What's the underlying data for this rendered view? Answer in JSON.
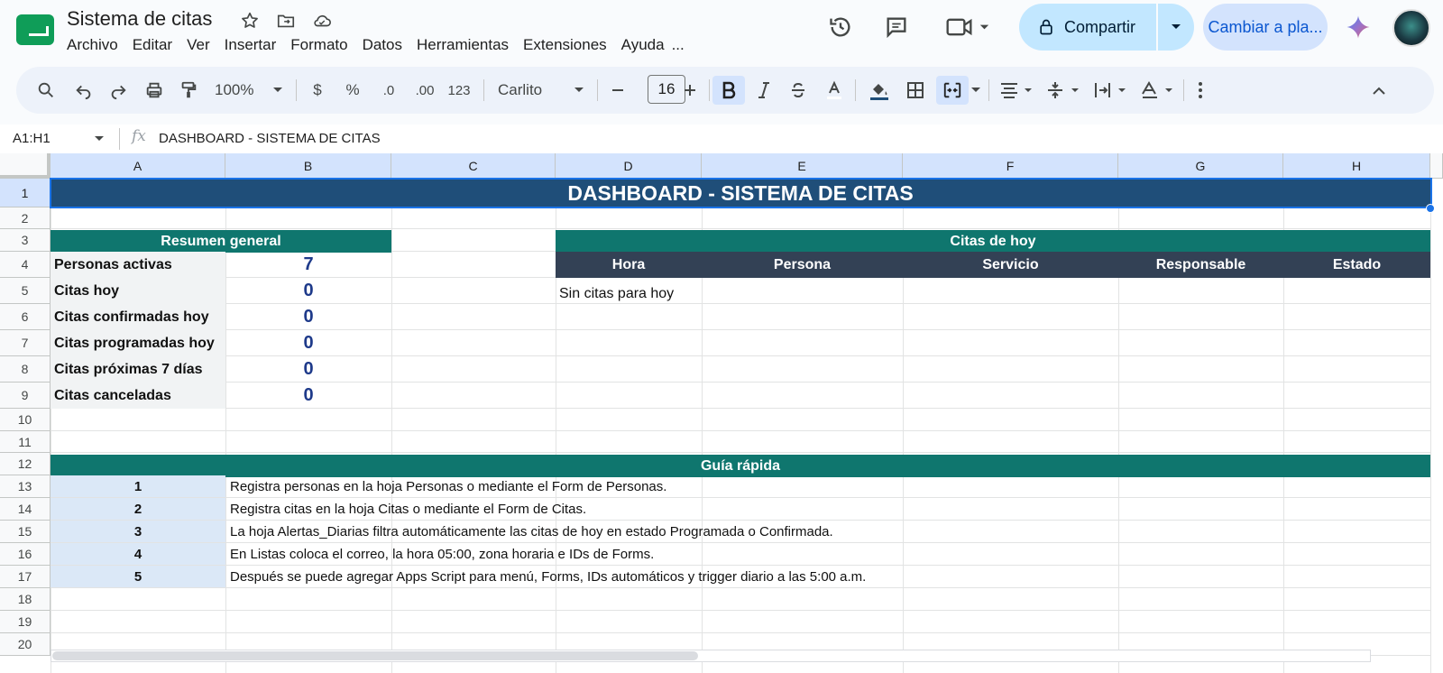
{
  "app": {
    "title": "Sistema de citas",
    "menu": [
      "Archivo",
      "Editar",
      "Ver",
      "Insertar",
      "Formato",
      "Datos",
      "Herramientas",
      "Extensiones",
      "Ayuda",
      "..."
    ],
    "share_label": "Compartir",
    "switch_label": "Cambiar a pla...",
    "accent": "#c2e7ff"
  },
  "toolbar": {
    "zoom": "100%",
    "currency": "$",
    "percent": "%",
    "dec_decrease": ".0",
    "dec_increase": ".00",
    "format_123": "123",
    "font": "Carlito",
    "font_size": "16"
  },
  "formula_bar": {
    "range": "A1:H1",
    "content": "DASHBOARD - SISTEMA DE CITAS"
  },
  "columns": [
    "A",
    "B",
    "C",
    "D",
    "E",
    "F",
    "G",
    "H"
  ],
  "rows": [
    "1",
    "2",
    "3",
    "4",
    "5",
    "6",
    "7",
    "8",
    "9",
    "10",
    "11",
    "12",
    "13",
    "14",
    "15",
    "16",
    "17",
    "18",
    "19",
    "20"
  ],
  "sheet": {
    "title": "DASHBOARD - SISTEMA DE CITAS",
    "title_color": "#1f4e79",
    "summary": {
      "header": "Resumen general",
      "items": [
        {
          "label": "Personas activas",
          "value": "7"
        },
        {
          "label": "Citas hoy",
          "value": "0"
        },
        {
          "label": "Citas confirmadas hoy",
          "value": "0"
        },
        {
          "label": "Citas programadas hoy",
          "value": "0"
        },
        {
          "label": "Citas próximas 7 días",
          "value": "0"
        },
        {
          "label": "Citas canceladas",
          "value": "0"
        }
      ]
    },
    "today": {
      "header": "Citas de hoy",
      "columns": [
        "Hora",
        "Persona",
        "Servicio",
        "Responsable",
        "Estado"
      ],
      "empty_message": "Sin citas para hoy"
    },
    "guide": {
      "header": "Guía rápida",
      "steps": [
        {
          "n": "1",
          "text": "Registra personas en la hoja Personas o mediante el Form de Personas."
        },
        {
          "n": "2",
          "text": "Registra citas en la hoja Citas o mediante el Form de Citas."
        },
        {
          "n": "3",
          "text": "La hoja Alertas_Diarias filtra automáticamente las citas de hoy en estado Programada o Confirmada."
        },
        {
          "n": "4",
          "text": "En Listas coloca el correo, la hora 05:00, zona horaria e IDs de Forms."
        },
        {
          "n": "5",
          "text": "Después se puede agregar Apps Script para menú, Forms, IDs automáticos y trigger diario a las 5:00 a.m."
        }
      ]
    },
    "colors": {
      "teal": "#0f766e",
      "slate": "#334155",
      "value": "#1e3a8a"
    }
  }
}
